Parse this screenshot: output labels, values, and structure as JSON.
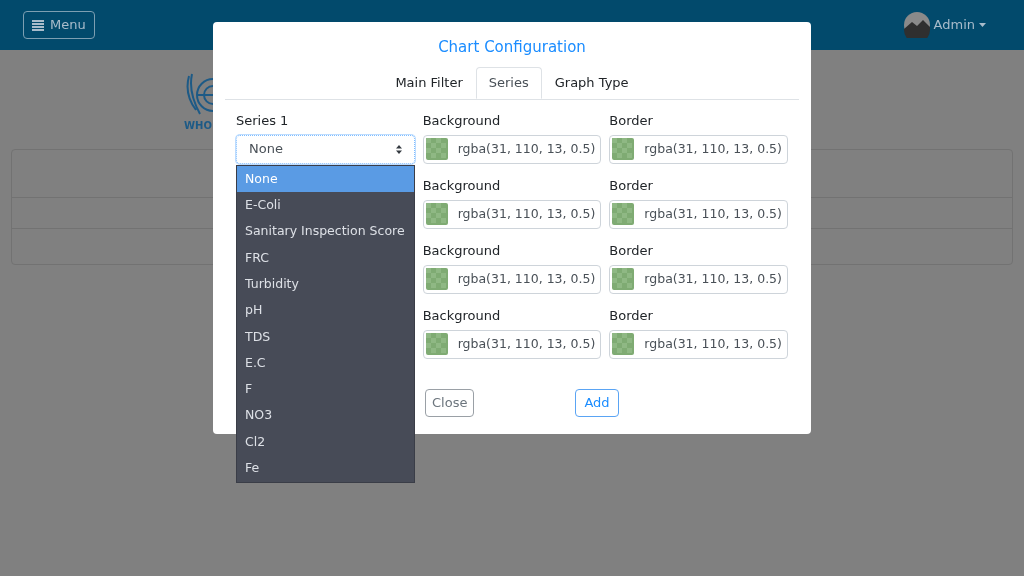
{
  "header": {
    "menu_button": "Menu",
    "user": "Admin"
  },
  "logo_text": "WHO",
  "modal": {
    "title": "Chart Configuration",
    "tabs": [
      {
        "label": "Main Filter",
        "selected": false
      },
      {
        "label": "Series",
        "selected": true
      },
      {
        "label": "Graph Type",
        "selected": false
      }
    ],
    "series": [
      {
        "label": "Series 1",
        "value": "None",
        "background_label": "Background",
        "background": "rgba(31, 110, 13, 0.5)",
        "border_label": "Border",
        "border": "rgba(31, 110, 13, 0.5)"
      },
      {
        "background_label": "Background",
        "background": "rgba(31, 110, 13, 0.5)",
        "border_label": "Border",
        "border": "rgba(31, 110, 13, 0.5)"
      },
      {
        "background_label": "Background",
        "background": "rgba(31, 110, 13, 0.5)",
        "border_label": "Border",
        "border": "rgba(31, 110, 13, 0.5)"
      },
      {
        "background_label": "Background",
        "background": "rgba(31, 110, 13, 0.5)",
        "border_label": "Border",
        "border": "rgba(31, 110, 13, 0.5)"
      }
    ],
    "buttons": [
      "Close",
      "Add"
    ]
  },
  "dropdown": [
    {
      "label": "None",
      "selected": true
    },
    {
      "label": "E-Coli",
      "selected": false
    },
    {
      "label": "Sanitary Inspection Score",
      "selected": false
    },
    {
      "label": "FRC",
      "selected": false
    },
    {
      "label": "Turbidity",
      "selected": false
    },
    {
      "label": "pH",
      "selected": false
    },
    {
      "label": "TDS",
      "selected": false
    },
    {
      "label": "E.C",
      "selected": false
    },
    {
      "label": "F",
      "selected": false
    },
    {
      "label": "NO3",
      "selected": false
    },
    {
      "label": "Cl2",
      "selected": false
    },
    {
      "label": "Fe",
      "selected": false
    }
  ]
}
